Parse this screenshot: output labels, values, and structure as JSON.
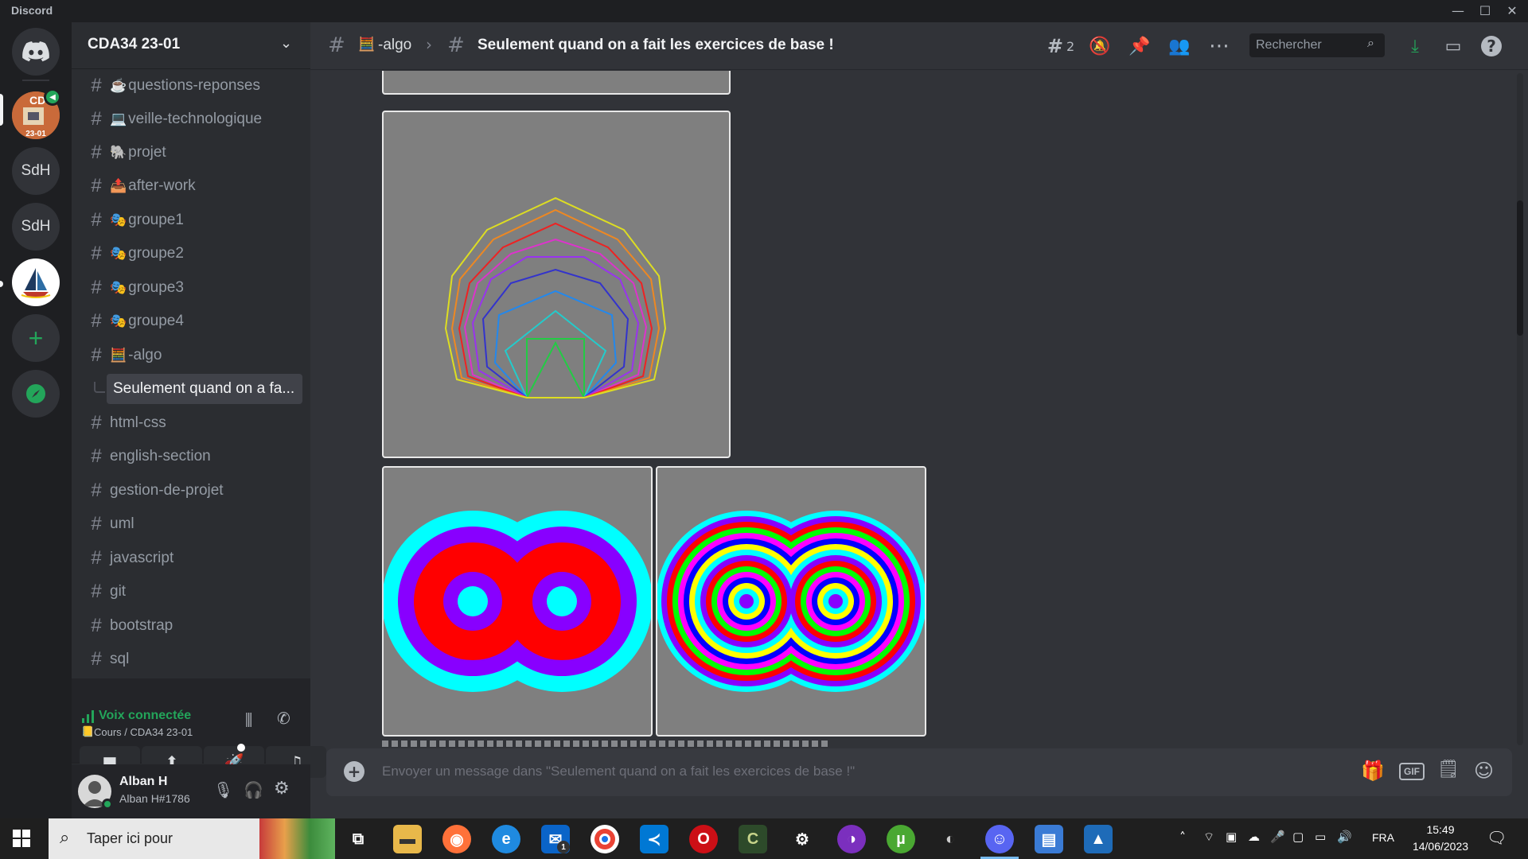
{
  "window": {
    "app_name": "Discord",
    "minimize": "—",
    "maximize": "☐",
    "close": "✕"
  },
  "servers": [
    {
      "label": ""
    },
    {
      "label": "SdH"
    },
    {
      "label": "SdH"
    }
  ],
  "guild": {
    "name": "CDA34 23-01"
  },
  "channels": [
    {
      "emoji": "☕",
      "name": "questions-reponses"
    },
    {
      "emoji": "💻",
      "name": "veille-technologique"
    },
    {
      "emoji": "🐘",
      "name": "projet"
    },
    {
      "emoji": "📤",
      "name": "after-work"
    },
    {
      "emoji": "🎭",
      "name": "groupe1"
    },
    {
      "emoji": "🎭",
      "name": "groupe2"
    },
    {
      "emoji": "🎭",
      "name": "groupe3"
    },
    {
      "emoji": "🎭",
      "name": "groupe4"
    },
    {
      "emoji": "🧮",
      "name": "-algo"
    },
    {
      "emoji": "",
      "name": "Seulement quand on a fa..."
    },
    {
      "emoji": "",
      "name": "html-css"
    },
    {
      "emoji": "",
      "name": "english-section"
    },
    {
      "emoji": "",
      "name": "gestion-de-projet"
    },
    {
      "emoji": "",
      "name": "uml"
    },
    {
      "emoji": "",
      "name": "javascript"
    },
    {
      "emoji": "",
      "name": "git"
    },
    {
      "emoji": "",
      "name": "bootstrap"
    },
    {
      "emoji": "",
      "name": "sql"
    }
  ],
  "voice": {
    "status": "Voix connectée",
    "location": "Cours / CDA34 23-01"
  },
  "user": {
    "name": "Alban H",
    "tag": "Alban H#1786"
  },
  "header": {
    "parent_channel": "-algo",
    "parent_emoji": "🧮",
    "thread_title": "Seulement quand on a fait les exercices de base !",
    "thread_count": "2",
    "search_placeholder": "Rechercher"
  },
  "composer": {
    "placeholder": "Envoyer un message dans \"Seulement quand on a fait les exercices de base !\""
  },
  "taskbar": {
    "search_text": "Taper ici pour",
    "mail_badge": "1",
    "language": "FRA",
    "time": "15:49",
    "date": "14/06/2023"
  },
  "colors": {
    "accent_green": "#23a55a",
    "discord_blurple": "#5865f2",
    "canvas_gray": "#7f7f7f"
  }
}
